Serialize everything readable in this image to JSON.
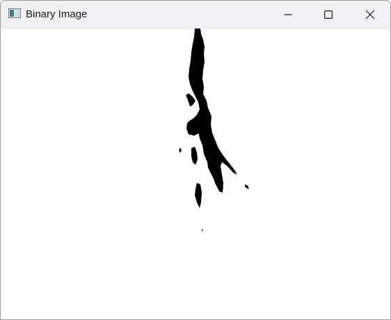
{
  "window": {
    "title": "Binary Image",
    "app_icon": "opencv-window-icon"
  },
  "controls": {
    "minimize_icon": "minimize-icon",
    "maximize_icon": "maximize-icon",
    "close_icon": "close-icon"
  },
  "image": {
    "type": "binary",
    "foreground_color": "#000000",
    "background_color": "#ffffff"
  }
}
